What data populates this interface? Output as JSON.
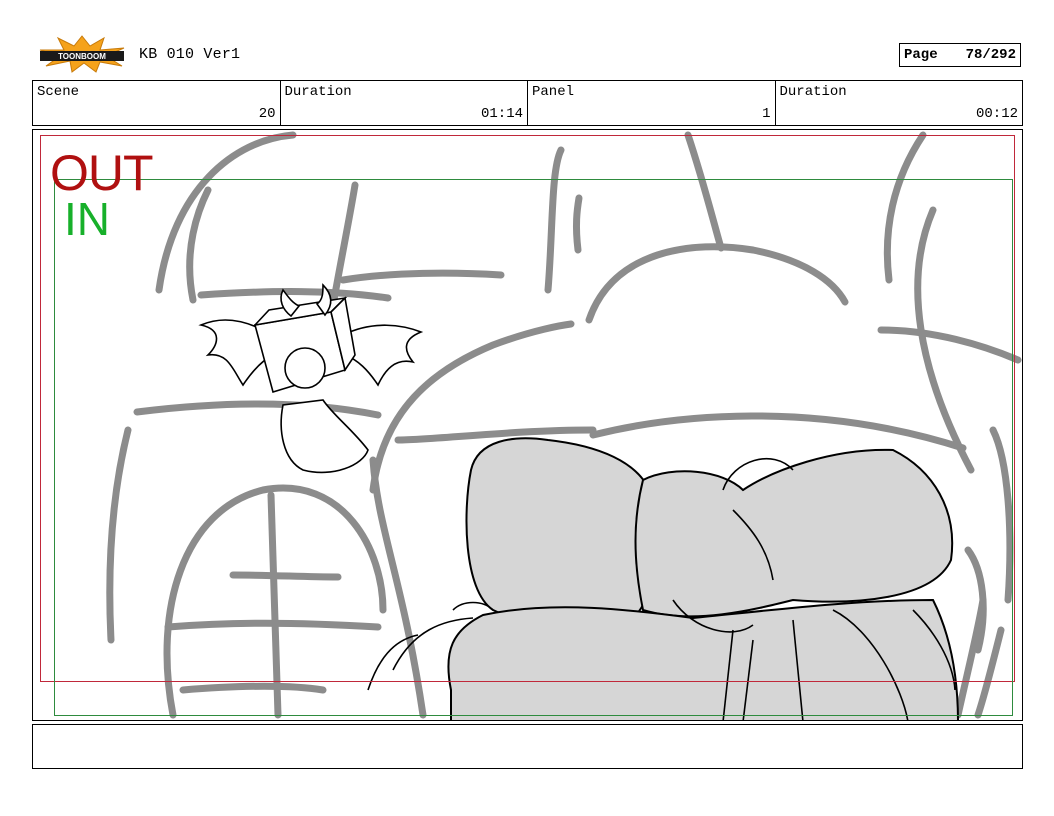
{
  "header": {
    "logo_alt": "Toon Boom logo",
    "logo_text": "TOONBOOM",
    "doc_title": "KB 010 Ver1",
    "page_label": "Page",
    "page_value": "78/292"
  },
  "info": {
    "scene_label": "Scene",
    "scene_value": "20",
    "scene_duration_label": "Duration",
    "scene_duration_value": "01:14",
    "panel_label": "Panel",
    "panel_value": "1",
    "panel_duration_label": "Duration",
    "panel_duration_value": "00:12"
  },
  "panel_view": {
    "out_label": "OUT",
    "in_label": "IN",
    "colors": {
      "out_frame": "#c0283a",
      "in_frame": "#2e8b3e",
      "out_text": "#b01010",
      "in_text": "#17b02a",
      "sketch_gray": "#8c8c8c",
      "fill_gray": "#d6d6d6"
    }
  },
  "notes": {
    "text": ""
  }
}
